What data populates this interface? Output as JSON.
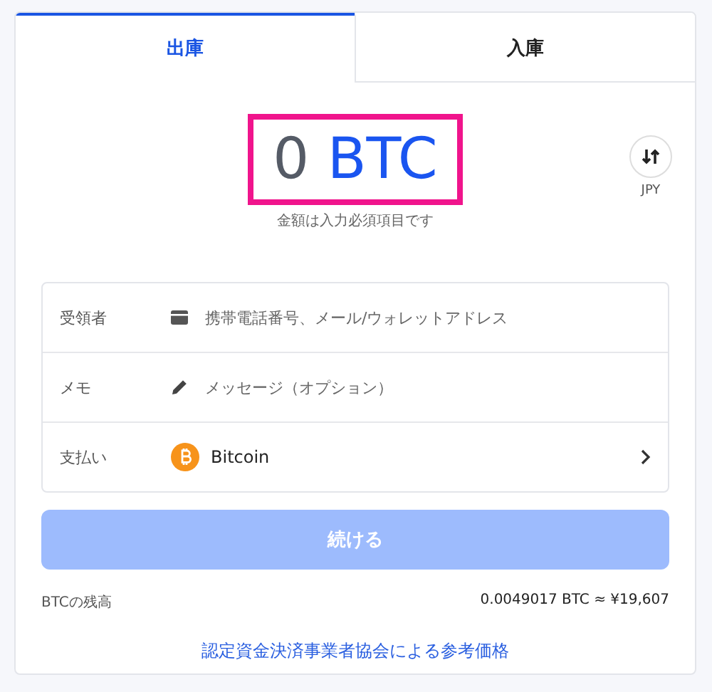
{
  "tabs": [
    {
      "label": "出庫",
      "selected": true
    },
    {
      "label": "入庫",
      "selected": false
    }
  ],
  "amount": {
    "value": "0",
    "unit": "BTC",
    "hint": "金額は入力必須項目です",
    "highlighted": true
  },
  "currency_toggle": {
    "label": "JPY"
  },
  "form_rows": [
    {
      "kind": "recipient",
      "label": "受領者",
      "placeholder": "携帯電話番号、メール/ウォレットアドレス"
    },
    {
      "kind": "memo",
      "label": "メモ",
      "placeholder": "メッセージ（オプション）"
    },
    {
      "kind": "payment",
      "label": "支払い",
      "value": "Bitcoin"
    }
  ],
  "continue_button": {
    "label": "続ける",
    "disabled": true
  },
  "balance": {
    "label": "BTCの残高",
    "value": "0.0049017 BTC ≈ ¥19,607"
  },
  "reference_link": "認定資金決済事業者協会による参考価格"
}
